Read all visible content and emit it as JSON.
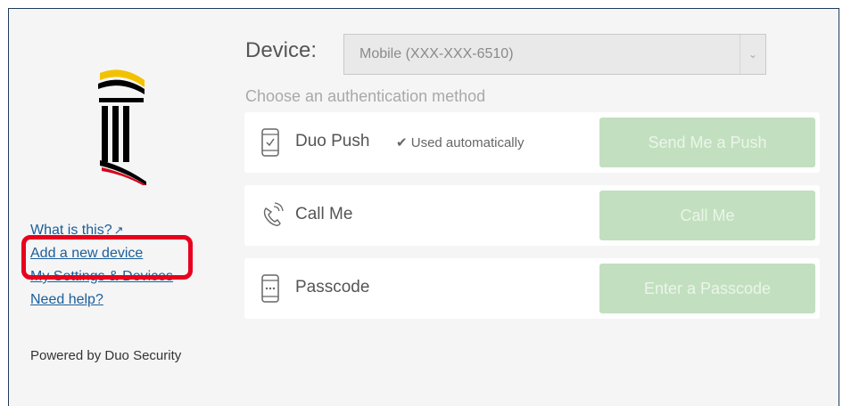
{
  "sidebar": {
    "what_is_this": "What is this?",
    "ext_icon": "↗",
    "add_device": "Add a new device",
    "my_settings": "My Settings & Devices",
    "need_help": "Need help?",
    "powered_by": "Powered by Duo Security"
  },
  "device": {
    "label": "Device:",
    "selected": "Mobile (XXX-XXX-6510)"
  },
  "choose_method": "Choose an authentication method",
  "methods": [
    {
      "icon": "smartphone-check-icon",
      "label": "Duo Push",
      "note": "Used automatically",
      "button": "Send Me a Push"
    },
    {
      "icon": "phone-call-icon",
      "label": "Call Me",
      "button": "Call Me"
    },
    {
      "icon": "passcode-device-icon",
      "label": "Passcode",
      "button": "Enter a Passcode"
    }
  ],
  "colors": {
    "accent_link": "#1a5e9a",
    "button_disabled_bg": "#c2e0bf",
    "highlight": "#e8001e",
    "frame_border": "#1f3a5c"
  }
}
